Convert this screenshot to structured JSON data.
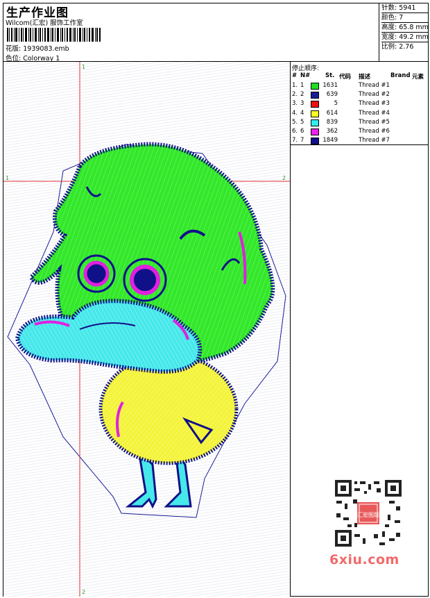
{
  "header": {
    "title": "生产作业图",
    "studio": "Wilcom(汇宏) 服饰工作室",
    "file_label": "花版:",
    "file_value": "1939083.emb",
    "colorway_label": "色位:",
    "colorway_value": "Colorway 1"
  },
  "stats": [
    {
      "label": "针数:",
      "value": "5941"
    },
    {
      "label": "颜色:",
      "value": "7"
    },
    {
      "label": "高度:",
      "value": "65.8 mm"
    },
    {
      "label": "宽度:",
      "value": "49.2 mm"
    },
    {
      "label": "比例:",
      "value": "2.76"
    }
  ],
  "thread_panel": {
    "title": "停止顺序:",
    "headers": {
      "hash": "#",
      "n": "N#",
      "st": "St.",
      "code": "代码",
      "desc": "描述",
      "brand": "Brand",
      "element": "元素"
    },
    "rows": [
      {
        "idx": "1.",
        "n": "1",
        "st": "1631",
        "color": "#22dd22",
        "desc": "Thread #1"
      },
      {
        "idx": "2.",
        "n": "2",
        "st": "639",
        "color": "#1a1a99",
        "desc": "Thread #2"
      },
      {
        "idx": "3.",
        "n": "3",
        "st": "5",
        "color": "#ee1111",
        "desc": "Thread #3"
      },
      {
        "idx": "4.",
        "n": "4",
        "st": "614",
        "color": "#ffff22",
        "desc": "Thread #4"
      },
      {
        "idx": "5.",
        "n": "5",
        "st": "839",
        "color": "#33eeee",
        "desc": "Thread #5"
      },
      {
        "idx": "6.",
        "n": "6",
        "st": "362",
        "color": "#ee22ee",
        "desc": "Thread #6"
      },
      {
        "idx": "7.",
        "n": "7",
        "st": "1849",
        "color": "#101088",
        "desc": "Thread #7"
      }
    ]
  },
  "guides": {
    "v_top": "1",
    "v_bottom": "2",
    "h_left": "1",
    "h_right": "2",
    "color": "#e03030"
  },
  "watermark": {
    "site": "6xiu.com",
    "stamp": "汇宏图版"
  }
}
